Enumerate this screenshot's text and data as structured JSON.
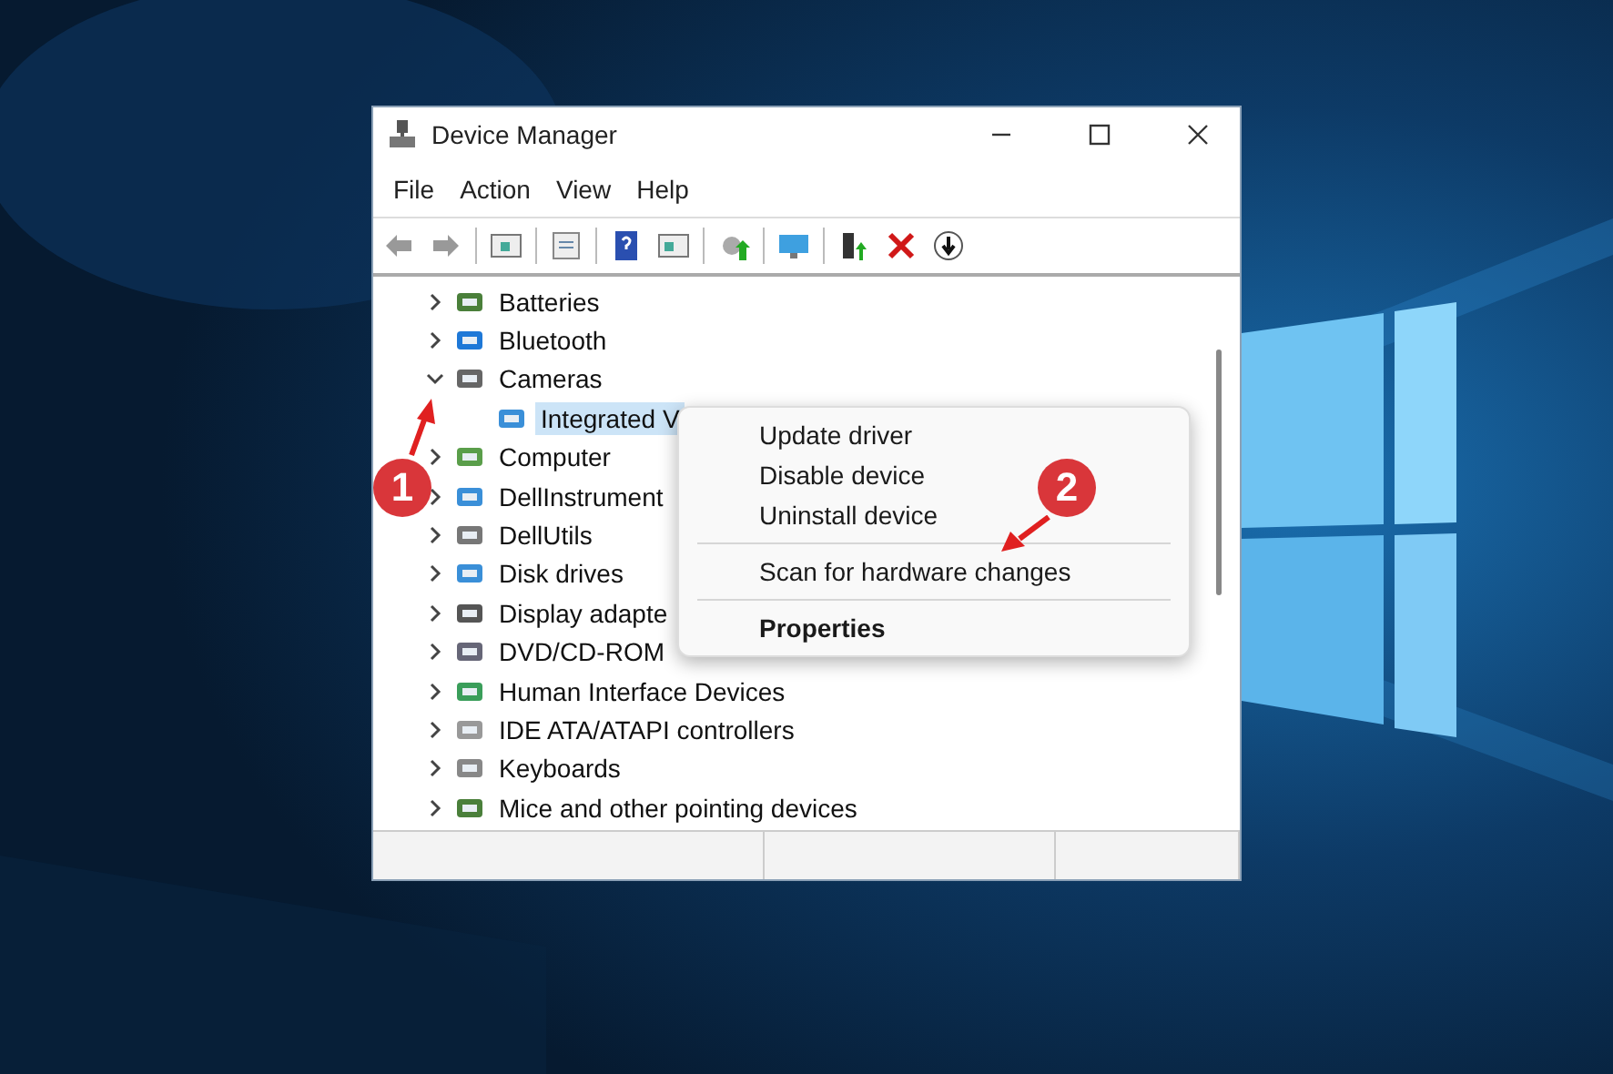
{
  "window": {
    "title": "Device Manager"
  },
  "menu_bar": [
    "File",
    "Action",
    "View",
    "Help"
  ],
  "tree": [
    {
      "label": "Batteries",
      "expanded": false,
      "selected": false
    },
    {
      "label": "Bluetooth",
      "expanded": false,
      "selected": false
    },
    {
      "label": "Cameras",
      "expanded": true,
      "selected": false,
      "children": [
        {
          "label": "Integrated V",
          "selected": true
        }
      ]
    },
    {
      "label": "Computer",
      "expanded": false,
      "selected": false
    },
    {
      "label": "DellInstrument",
      "expanded": false,
      "selected": false
    },
    {
      "label": "DellUtils",
      "expanded": false,
      "selected": false
    },
    {
      "label": "Disk drives",
      "expanded": false,
      "selected": false
    },
    {
      "label": "Display adapte",
      "expanded": false,
      "selected": false
    },
    {
      "label": "DVD/CD-ROM",
      "expanded": false,
      "selected": false
    },
    {
      "label": "Human Interface Devices",
      "expanded": false,
      "selected": false
    },
    {
      "label": "IDE ATA/ATAPI controllers",
      "expanded": false,
      "selected": false
    },
    {
      "label": "Keyboards",
      "expanded": false,
      "selected": false
    },
    {
      "label": "Mice and other pointing devices",
      "expanded": false,
      "selected": false
    }
  ],
  "context_menu": [
    {
      "kind": "item",
      "label": "Update driver"
    },
    {
      "kind": "item",
      "label": "Disable device"
    },
    {
      "kind": "item",
      "label": "Uninstall device"
    },
    {
      "kind": "separator"
    },
    {
      "kind": "item",
      "label": "Scan for hardware changes"
    },
    {
      "kind": "separator"
    },
    {
      "kind": "default",
      "label": "Properties"
    }
  ],
  "annotations": [
    {
      "label": "1"
    },
    {
      "label": "2"
    }
  ]
}
